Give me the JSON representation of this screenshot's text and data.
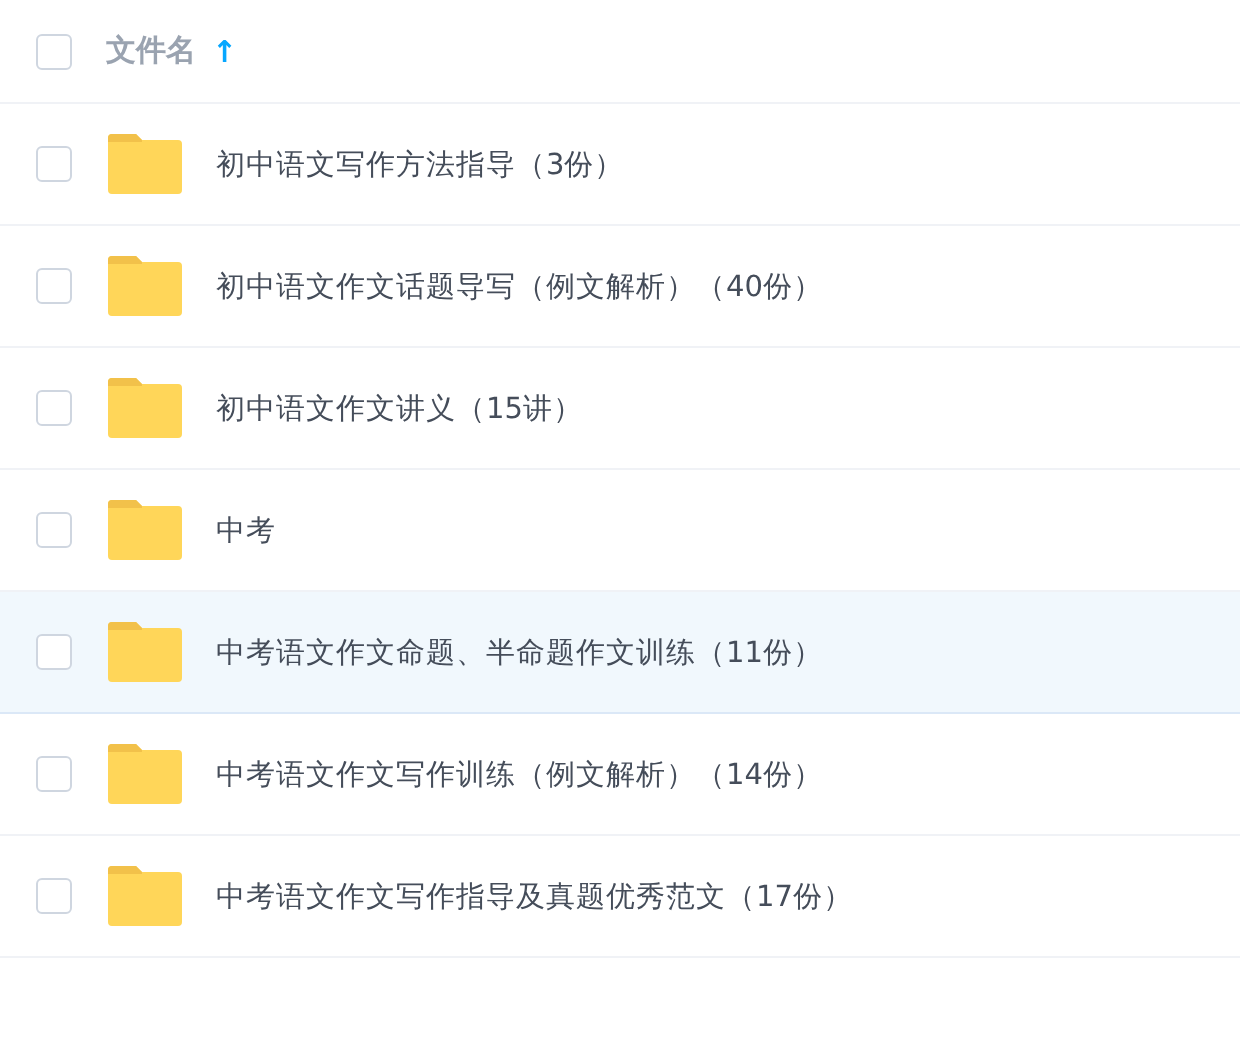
{
  "header": {
    "checked": false,
    "label": "文件名",
    "sort_icon": "↑"
  },
  "rows": [
    {
      "name": "初中语文写作方法指导（3份）",
      "checked": false,
      "highlighted": false
    },
    {
      "name": "初中语文作文话题导写（例文解析）（40份）",
      "checked": false,
      "highlighted": false
    },
    {
      "name": "初中语文作文讲义（15讲）",
      "checked": false,
      "highlighted": false
    },
    {
      "name": "中考",
      "checked": false,
      "highlighted": false
    },
    {
      "name": "中考语文作文命题、半命题作文训练（11份）",
      "checked": false,
      "highlighted": true
    },
    {
      "name": "中考语文作文写作训练（例文解析）（14份）",
      "checked": false,
      "highlighted": false
    },
    {
      "name": "中考语文作文写作指导及真题优秀范文（17份）",
      "checked": false,
      "highlighted": false
    }
  ]
}
